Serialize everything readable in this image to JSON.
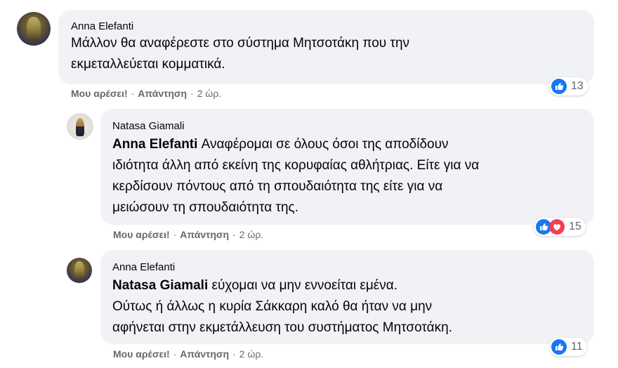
{
  "comments": [
    {
      "author": "Anna Elefanti",
      "lines": [
        "Μάλλον θα αναφέρεστε στο σύστημα Μητσοτάκη που την",
        "εκμεταλλεύεται κομματικά."
      ],
      "like_label": "Μου αρέσει!",
      "reply_label": "Απάντηση",
      "time": "2 ώρ.",
      "reaction_icons": [
        "like-icon"
      ],
      "reaction_count": "13"
    },
    {
      "author": "Natasa Giamali",
      "mention": "Anna Elefanti",
      "lines": [
        " Αναφέρομαι σε όλους όσοι της αποδίδουν",
        "ιδιότητα άλλη από εκείνη της κορυφαίας αθλήτριας. Είτε για να",
        "κερδίσουν πόντους από τη σπουδαιότητα της είτε για να",
        "μειώσουν τη σπουδαιότητα της."
      ],
      "like_label": "Μου αρέσει!",
      "reply_label": "Απάντηση",
      "time": "2 ώρ.",
      "reaction_icons": [
        "like-icon",
        "love-icon"
      ],
      "reaction_count": "15"
    },
    {
      "author": "Anna Elefanti",
      "mention": "Natasa Giamali",
      "lines": [
        " εύχομαι να μην εννοείται εμένα.",
        "Ούτως ή άλλως η κυρία Σάκκαρη καλό θα ήταν να μην",
        "αφήνεται στην εκμετάλλευση του συστήματος Μητσοτάκη."
      ],
      "like_label": "Μου αρέσει!",
      "reply_label": "Απάντηση",
      "time": "2 ώρ.",
      "reaction_icons": [
        "like-icon"
      ],
      "reaction_count": "11"
    }
  ],
  "separator": "·",
  "colors": {
    "bubble": "#f0f2f5",
    "meta_text": "#65676b",
    "like_blue": "#1877f2",
    "love_red": "#f33e58"
  }
}
